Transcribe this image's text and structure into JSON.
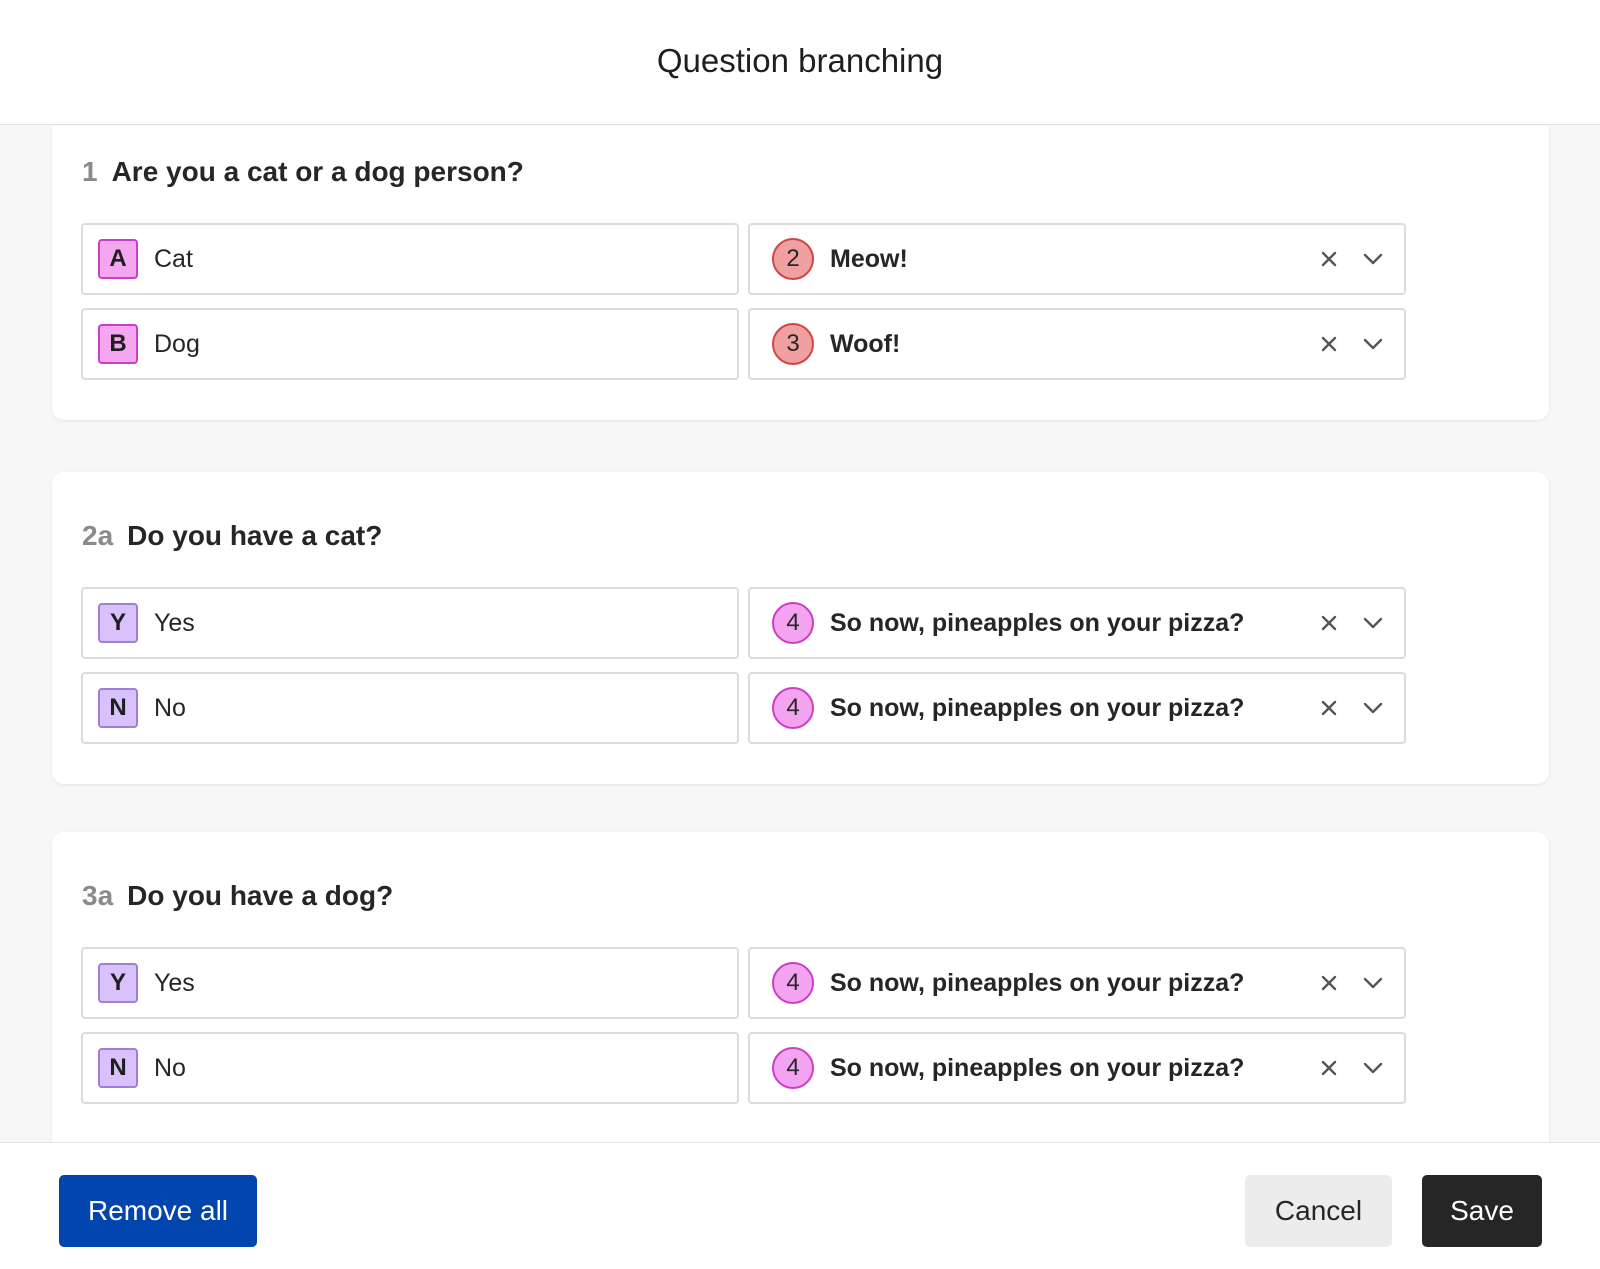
{
  "header": {
    "title": "Question branching"
  },
  "colors": {
    "key_pink_bg": "#f5a6f0",
    "key_pink_border": "#cc3fc4",
    "key_purple_bg": "#d9c2fb",
    "key_purple_border": "#9d7fd8",
    "badge_red_bg": "#f0a0a0",
    "badge_red_border": "#d04545",
    "badge_pink_bg": "#f4a3f0",
    "badge_pink_border": "#cc3fc4",
    "remove_all": "#0345ae",
    "save": "#262626",
    "cancel": "#ececec"
  },
  "questions": [
    {
      "number": "1",
      "text": "Are you a cat or a dog person?",
      "answers": [
        {
          "key": "A",
          "label": "Cat",
          "target_number": "2",
          "target_label": "Meow!"
        },
        {
          "key": "B",
          "label": "Dog",
          "target_number": "3",
          "target_label": "Woof!"
        }
      ]
    },
    {
      "number": "2a",
      "text": "Do you have a cat?",
      "answers": [
        {
          "key": "Y",
          "label": "Yes",
          "target_number": "4",
          "target_label": "So now, pineapples on your pizza?"
        },
        {
          "key": "N",
          "label": "No",
          "target_number": "4",
          "target_label": "So now, pineapples on your pizza?"
        }
      ]
    },
    {
      "number": "3a",
      "text": "Do you have a dog?",
      "answers": [
        {
          "key": "Y",
          "label": "Yes",
          "target_number": "4",
          "target_label": "So now, pineapples on your pizza?"
        },
        {
          "key": "N",
          "label": "No",
          "target_number": "4",
          "target_label": "So now, pineapples on your pizza?"
        }
      ]
    }
  ],
  "icons": {
    "clear": "close-icon",
    "dropdown": "chevron-down-icon"
  },
  "footer": {
    "remove_all_label": "Remove all",
    "cancel_label": "Cancel",
    "save_label": "Save"
  }
}
